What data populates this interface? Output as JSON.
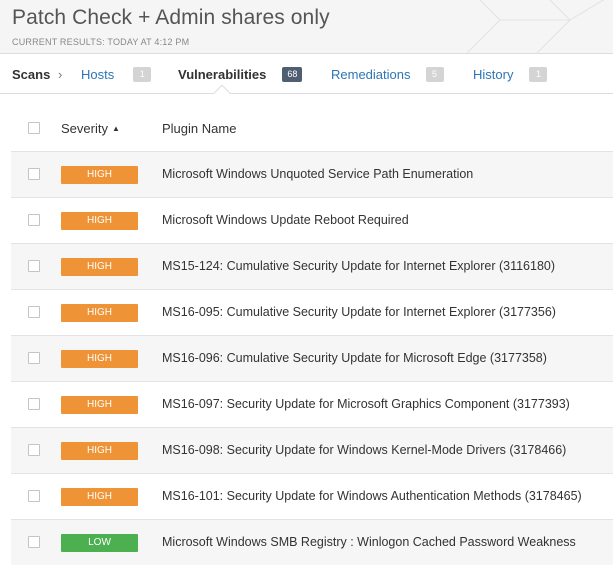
{
  "header": {
    "title": "Patch Check + Admin shares only",
    "subtitle": "CURRENT RESULTS: TODAY AT 4:12 PM"
  },
  "tabs": {
    "scans_label": "Scans",
    "items": [
      {
        "label": "Hosts",
        "count": "1"
      },
      {
        "label": "Vulnerabilities",
        "count": "68",
        "active": true
      },
      {
        "label": "Remediations",
        "count": "5"
      },
      {
        "label": "History",
        "count": "1"
      }
    ]
  },
  "table": {
    "columns": [
      "Severity",
      "Plugin Name"
    ],
    "sort_indicator": "▲",
    "rows": [
      {
        "severity": "HIGH",
        "plugin": "Microsoft Windows Unquoted Service Path Enumeration"
      },
      {
        "severity": "HIGH",
        "plugin": "Microsoft Windows Update Reboot Required"
      },
      {
        "severity": "HIGH",
        "plugin": "MS15-124: Cumulative Security Update for Internet Explorer (3116180)"
      },
      {
        "severity": "HIGH",
        "plugin": "MS16-095: Cumulative Security Update for Internet Explorer (3177356)"
      },
      {
        "severity": "HIGH",
        "plugin": "MS16-096: Cumulative Security Update for Microsoft Edge (3177358)"
      },
      {
        "severity": "HIGH",
        "plugin": "MS16-097: Security Update for Microsoft Graphics Component (3177393)"
      },
      {
        "severity": "HIGH",
        "plugin": "MS16-098: Security Update for Windows Kernel-Mode Drivers (3178466)"
      },
      {
        "severity": "HIGH",
        "plugin": "MS16-101: Security Update for Windows Authentication Methods (3178465)"
      },
      {
        "severity": "LOW",
        "plugin": "Microsoft Windows SMB Registry : Winlogon Cached Password Weakness"
      }
    ]
  },
  "colors": {
    "high": "#ee9336",
    "low": "#4caf50",
    "link": "#2d76b7",
    "active_badge": "#4f5e70"
  }
}
